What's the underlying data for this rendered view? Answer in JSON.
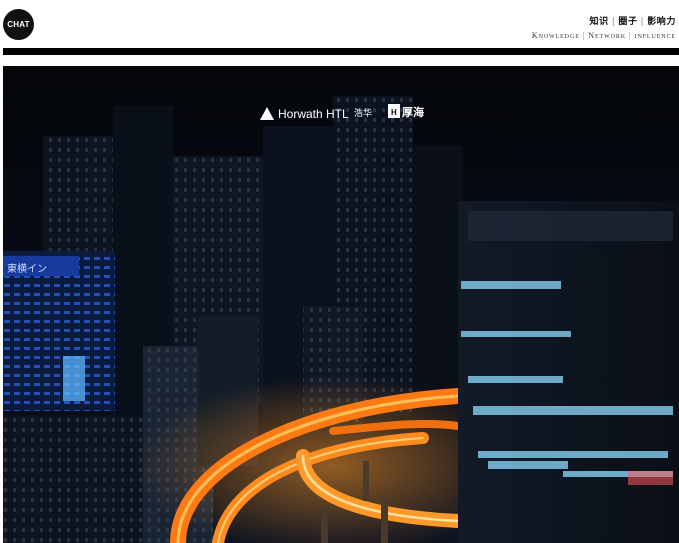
{
  "header": {
    "logo_text": "CHAT",
    "tagline_cn": [
      "知识",
      "圈子",
      "影响力"
    ],
    "tagline_en": [
      "Knowledge",
      "Network",
      "influence"
    ]
  },
  "hero": {
    "brand_left_name": "Horwath HTL",
    "brand_left_cn": "浩华",
    "brand_right_mark": "H",
    "brand_right_cn": "厚海",
    "sign_text": "東横イン"
  },
  "colors": {
    "divider": "#000000",
    "night_sky": "#05070c",
    "highway_orange": "#ff8a1e",
    "neon_blue": "#2f6bff"
  }
}
